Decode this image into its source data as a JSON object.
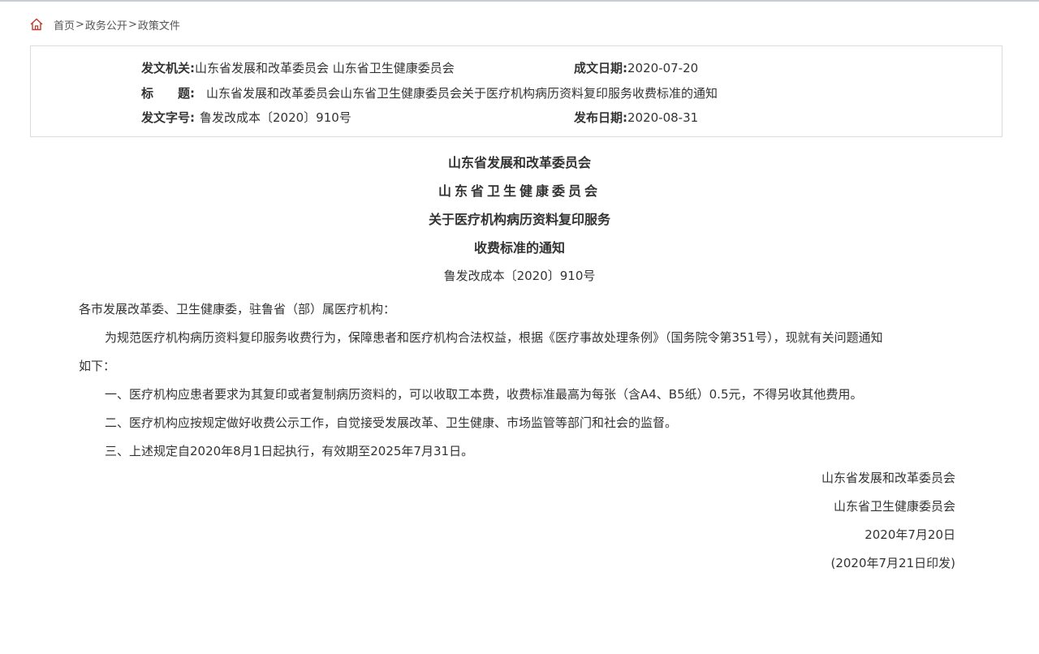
{
  "breadcrumb": {
    "home": "首页",
    "sep": ">",
    "section": "政务公开",
    "current": "政策文件"
  },
  "meta": {
    "issuer_label": "发文机关:",
    "issuer": "山东省发展和改革委员会 山东省卫生健康委员会",
    "written_date_label": "成文日期:",
    "written_date": "2020-07-20",
    "title_label": "标　　题:",
    "title": "山东省发展和改革委员会山东省卫生健康委员会关于医疗机构病历资料复印服务收费标准的通知",
    "doc_no_label": "发文字号:",
    "doc_no": "鲁发改成本〔2020〕910号",
    "publish_date_label": "发布日期:",
    "publish_date": "2020-08-31"
  },
  "document": {
    "title_line1": "山东省发展和改革委员会",
    "title_line2": "山东省卫生健康委员会",
    "title_line3": "关于医疗机构病历资料复印服务",
    "title_line4": "收费标准的通知",
    "doc_number": "鲁发改成本〔2020〕910号",
    "salutation": "各市发展改革委、卫生健康委，驻鲁省（部）属医疗机构：",
    "intro_line1": "为规范医疗机构病历资料复印服务收费行为，保障患者和医疗机构合法权益，根据《医疗事故处理条例》（国务院令第351号），现就有关问题通知",
    "intro_line2": "如下：",
    "item1": "一、医疗机构应患者要求为其复印或者复制病历资料的，可以收取工本费，收费标准最高为每张（含A4、B5纸）0.5元，不得另收其他费用。",
    "item2": "二、医疗机构应按规定做好收费公示工作，自觉接受发展改革、卫生健康、市场监管等部门和社会的监督。",
    "item3": "三、上述规定自2020年8月1日起执行，有效期至2025年7月31日。",
    "signer1": "山东省发展和改革委员会",
    "signer2": "山东省卫生健康委员会",
    "sign_date": "2020年7月20日",
    "print_date": "(2020年7月21日印发)"
  },
  "colors": {
    "home_icon": "#c0392b",
    "text": "#333333",
    "border": "#dcdcdc"
  },
  "icons": {
    "home": "home-icon"
  }
}
